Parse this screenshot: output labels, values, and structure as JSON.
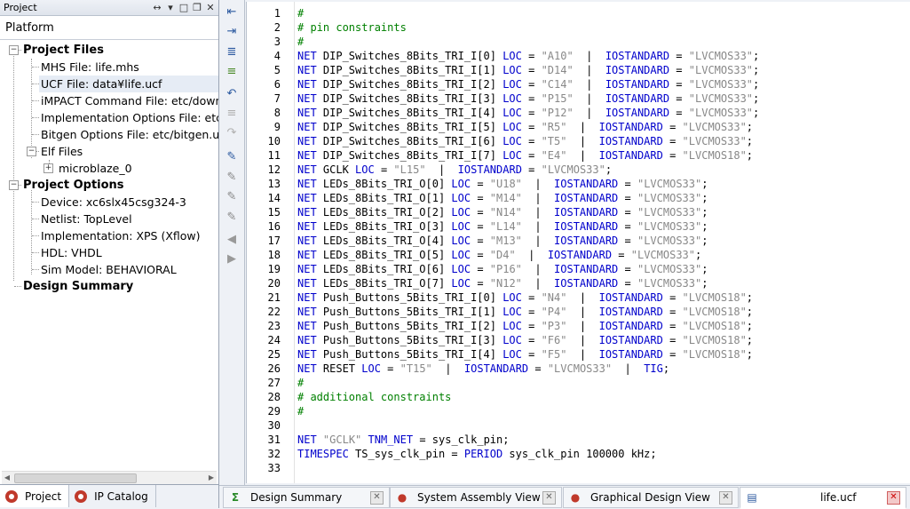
{
  "panel": {
    "title": "Project",
    "platform_tab": "Platform"
  },
  "tree": [
    {
      "label": "Project Files",
      "bold": true,
      "selected": false
    },
    {
      "label": "MHS File: life.mhs",
      "bold": false,
      "selected": false
    },
    {
      "label": "UCF File: data¥life.ucf",
      "bold": false,
      "selected": true
    },
    {
      "label": "iMPACT Command File: etc/download.cmd",
      "bold": false,
      "selected": false
    },
    {
      "label": "Implementation Options File: etc/fast_runtime.opt",
      "bold": false,
      "selected": false
    },
    {
      "label": "Bitgen Options File: etc/bitgen.ut",
      "bold": false,
      "selected": false
    },
    {
      "label": "Elf Files",
      "bold": false,
      "selected": false
    },
    {
      "label": "microblaze_0",
      "bold": false,
      "selected": false
    },
    {
      "label": "Project Options",
      "bold": true,
      "selected": false
    },
    {
      "label": "Device: xc6slx45csg324-3",
      "bold": false,
      "selected": false
    },
    {
      "label": "Netlist: TopLevel",
      "bold": false,
      "selected": false
    },
    {
      "label": "Implementation: XPS (Xflow)",
      "bold": false,
      "selected": false
    },
    {
      "label": "HDL: VHDL",
      "bold": false,
      "selected": false
    },
    {
      "label": "Sim Model: BEHAVIORAL",
      "bold": false,
      "selected": false
    },
    {
      "label": "Design Summary",
      "bold": true,
      "selected": false
    }
  ],
  "bottom_tabs": [
    {
      "label": "Project",
      "active": true
    },
    {
      "label": "IP Catalog",
      "active": false
    }
  ],
  "editor_tabs": [
    {
      "label": "Design Summary",
      "icon": "Σ",
      "active": false
    },
    {
      "label": "System Assembly View",
      "icon": "●",
      "active": false
    },
    {
      "label": "Graphical Design View",
      "icon": "●",
      "active": false
    },
    {
      "label": "life.ucf",
      "icon": "▤",
      "active": true
    }
  ],
  "code_lines": [
    "#",
    "# pin constraints",
    "#",
    "NET DIP_Switches_8Bits_TRI_I[0] LOC = \"A10\"  |  IOSTANDARD = \"LVCMOS33\";",
    "NET DIP_Switches_8Bits_TRI_I[1] LOC = \"D14\"  |  IOSTANDARD = \"LVCMOS33\";",
    "NET DIP_Switches_8Bits_TRI_I[2] LOC = \"C14\"  |  IOSTANDARD = \"LVCMOS33\";",
    "NET DIP_Switches_8Bits_TRI_I[3] LOC = \"P15\"  |  IOSTANDARD = \"LVCMOS33\";",
    "NET DIP_Switches_8Bits_TRI_I[4] LOC = \"P12\"  |  IOSTANDARD = \"LVCMOS33\";",
    "NET DIP_Switches_8Bits_TRI_I[5] LOC = \"R5\"  |  IOSTANDARD = \"LVCMOS33\";",
    "NET DIP_Switches_8Bits_TRI_I[6] LOC = \"T5\"  |  IOSTANDARD = \"LVCMOS33\";",
    "NET DIP_Switches_8Bits_TRI_I[7] LOC = \"E4\"  |  IOSTANDARD = \"LVCMOS18\";",
    "NET GCLK LOC = \"L15\"  |  IOSTANDARD = \"LVCMOS33\";",
    "NET LEDs_8Bits_TRI_O[0] LOC = \"U18\"  |  IOSTANDARD = \"LVCMOS33\";",
    "NET LEDs_8Bits_TRI_O[1] LOC = \"M14\"  |  IOSTANDARD = \"LVCMOS33\";",
    "NET LEDs_8Bits_TRI_O[2] LOC = \"N14\"  |  IOSTANDARD = \"LVCMOS33\";",
    "NET LEDs_8Bits_TRI_O[3] LOC = \"L14\"  |  IOSTANDARD = \"LVCMOS33\";",
    "NET LEDs_8Bits_TRI_O[4] LOC = \"M13\"  |  IOSTANDARD = \"LVCMOS33\";",
    "NET LEDs_8Bits_TRI_O[5] LOC = \"D4\"  |  IOSTANDARD = \"LVCMOS33\";",
    "NET LEDs_8Bits_TRI_O[6] LOC = \"P16\"  |  IOSTANDARD = \"LVCMOS33\";",
    "NET LEDs_8Bits_TRI_O[7] LOC = \"N12\"  |  IOSTANDARD = \"LVCMOS33\";",
    "NET Push_Buttons_5Bits_TRI_I[0] LOC = \"N4\"  |  IOSTANDARD = \"LVCMOS18\";",
    "NET Push_Buttons_5Bits_TRI_I[1] LOC = \"P4\"  |  IOSTANDARD = \"LVCMOS18\";",
    "NET Push_Buttons_5Bits_TRI_I[2] LOC = \"P3\"  |  IOSTANDARD = \"LVCMOS18\";",
    "NET Push_Buttons_5Bits_TRI_I[3] LOC = \"F6\"  |  IOSTANDARD = \"LVCMOS18\";",
    "NET Push_Buttons_5Bits_TRI_I[4] LOC = \"F5\"  |  IOSTANDARD = \"LVCMOS18\";",
    "NET RESET LOC = \"T15\"  |  IOSTANDARD = \"LVCMOS33\"  |  TIG;",
    "#",
    "# additional constraints",
    "#",
    "",
    "NET \"GCLK\" TNM_NET = sys_clk_pin;",
    "TIMESPEC TS_sys_clk_pin = PERIOD sys_clk_pin 100000 kHz;",
    ""
  ],
  "colors": {
    "keyword": "#0000cc",
    "string": "#888888",
    "comment": "#008000",
    "text": "#000000"
  }
}
